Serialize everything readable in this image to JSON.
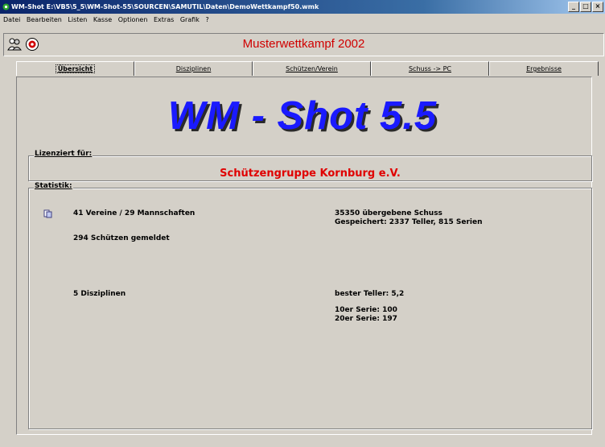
{
  "window": {
    "title": "WM-Shot E:\\VB5\\5_5\\WM-Shot-55\\SOURCEN\\SAMUTIL\\Daten\\DemoWettkampf50.wmk",
    "buttons": [
      "_",
      "□",
      "×"
    ]
  },
  "menu": [
    "Datei",
    "Bearbeiten",
    "Listen",
    "Kasse",
    "Optionen",
    "Extras",
    "Grafik",
    "?"
  ],
  "header": {
    "title": "Musterwettkampf 2002",
    "icons": [
      "users-icon",
      "target-icon"
    ]
  },
  "tabs": [
    "Übersicht",
    "Disziplinen",
    "Schützen/Verein",
    "Schuss -> PC",
    "Ergebnisse"
  ],
  "active_tab": 0,
  "overview": {
    "app_title": "WM - Shot 5.5",
    "license": {
      "label": "Lizenziert für:",
      "club": "Schützengruppe Kornburg e.V."
    },
    "stats": {
      "label": "Statistik:",
      "clubs_teams": "41 Vereine  / 29 Mannschaften",
      "shooters": "294 Schützen gemeldet",
      "disciplines": "5 Disziplinen",
      "shots_transferred": "35350 übergebene Schuss",
      "saved": "Gespeichert: 2337 Teller, 815 Serien",
      "best_teller": "bester Teller: 5,2",
      "series10": "10er Serie: 100",
      "series20": "20er Serie: 197"
    }
  },
  "colors": {
    "accent_red": "#d00000",
    "title_blue": "#1a1aff",
    "titlebar": "#0a246a"
  }
}
